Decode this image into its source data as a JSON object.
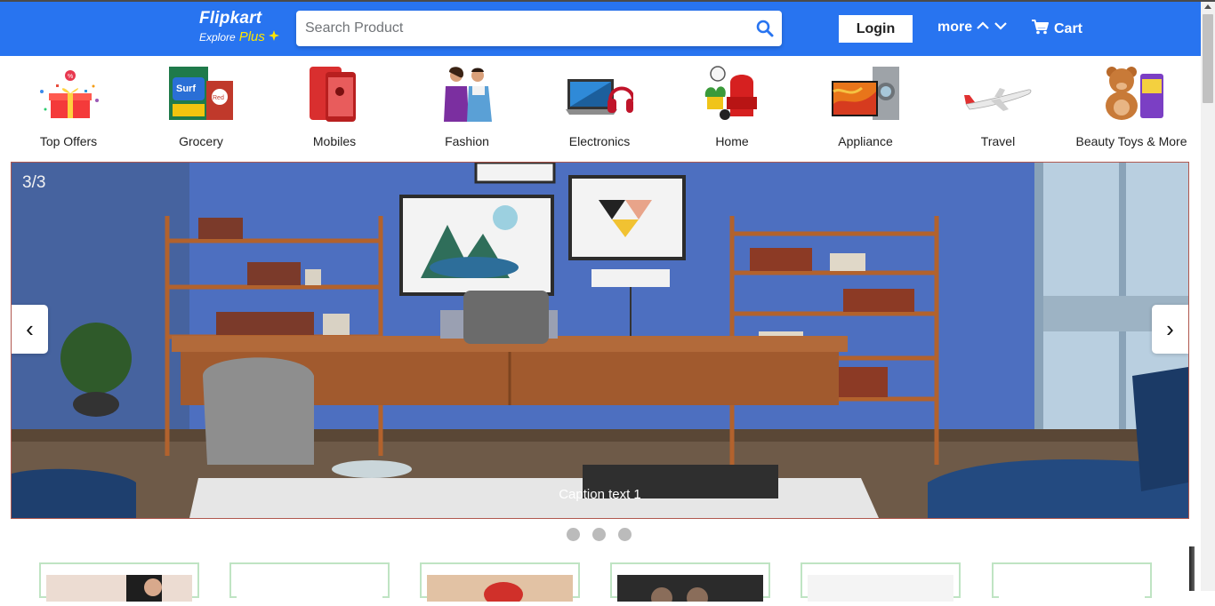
{
  "header": {
    "logo_text": "Flipkart",
    "logo_explore": "Explore",
    "logo_plus": "Plus",
    "search_placeholder": "Search Product",
    "login_label": "Login",
    "more_label": "more",
    "cart_label": "Cart",
    "brand_color": "#2874f0",
    "plus_color": "#ffe500"
  },
  "categories": [
    {
      "label": "Top Offers",
      "icon": "gift-offers-icon"
    },
    {
      "label": "Grocery",
      "icon": "grocery-icon"
    },
    {
      "label": "Mobiles",
      "icon": "mobile-phone-icon"
    },
    {
      "label": "Fashion",
      "icon": "fashion-icon"
    },
    {
      "label": "Electronics",
      "icon": "laptop-headphones-icon"
    },
    {
      "label": "Home",
      "icon": "home-furniture-icon"
    },
    {
      "label": "Appliance",
      "icon": "tv-washer-icon"
    },
    {
      "label": "Travel",
      "icon": "airplane-icon"
    },
    {
      "label": "Beauty Toys & More",
      "icon": "teddy-bear-icon"
    }
  ],
  "carousel": {
    "counter": "3/3",
    "caption": "Caption text 1",
    "prev_symbol": "‹",
    "next_symbol": "›",
    "dot_count": 3
  }
}
